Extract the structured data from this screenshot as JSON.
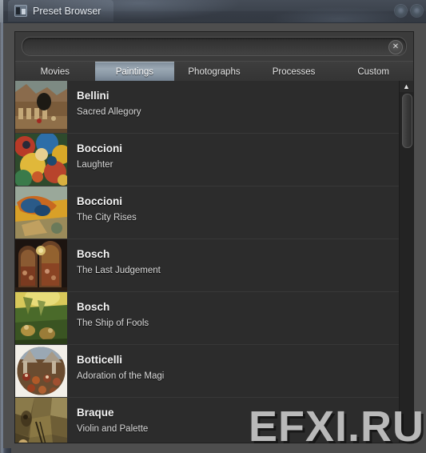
{
  "window": {
    "title": "Preset Browser",
    "app_icon": "preset-browser-icon",
    "buttons": [
      {
        "name": "window-button-minimize",
        "icon": "circle-icon"
      },
      {
        "name": "window-button-close",
        "icon": "circle-icon"
      }
    ]
  },
  "search": {
    "value": "",
    "placeholder": "",
    "clear_icon": "✕",
    "clear_label": "Clear search"
  },
  "tabs": [
    {
      "label": "Movies",
      "active": false
    },
    {
      "label": "Paintings",
      "active": true
    },
    {
      "label": "Photographs",
      "active": false
    },
    {
      "label": "Processes",
      "active": false
    },
    {
      "label": "Custom",
      "active": false
    }
  ],
  "list": {
    "items": [
      {
        "artist": "Bellini",
        "work": "Sacred Allegory",
        "thumb": "bellini-sacred-allegory"
      },
      {
        "artist": "Boccioni",
        "work": "Laughter",
        "thumb": "boccioni-laughter"
      },
      {
        "artist": "Boccioni",
        "work": "The City Rises",
        "thumb": "boccioni-the-city-rises"
      },
      {
        "artist": "Bosch",
        "work": "The Last Judgement",
        "thumb": "bosch-the-last-judgement"
      },
      {
        "artist": "Bosch",
        "work": "The Ship of Fools",
        "thumb": "bosch-the-ship-of-fools"
      },
      {
        "artist": "Botticelli",
        "work": "Adoration of the Magi",
        "thumb": "botticelli-adoration-of-the-magi"
      },
      {
        "artist": "Braque",
        "work": "Violin and Palette",
        "thumb": "braque-violin-and-palette"
      }
    ]
  },
  "scrollbar": {
    "up_arrow": "▲",
    "position_percent": 0
  },
  "watermark": {
    "text": "EFXI.RU"
  },
  "colors": {
    "accent_tab": "#9aa7b3",
    "panel_bg": "#262626",
    "row_bg": "#2c2c2c",
    "titlebar": "#3d444e",
    "text_primary": "#f2f2f2",
    "text_secondary": "#d9d9d9"
  }
}
